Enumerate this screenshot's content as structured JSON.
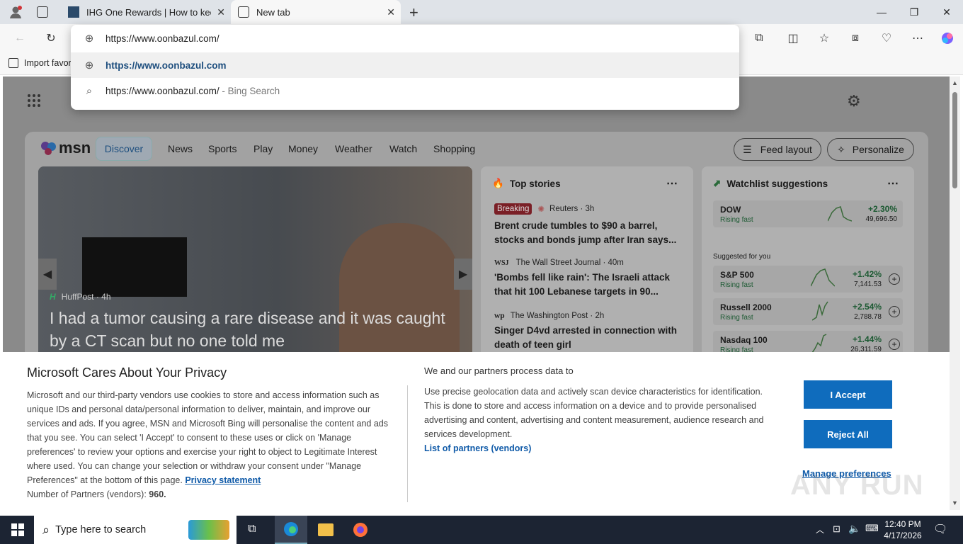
{
  "browser": {
    "tabs": [
      {
        "title": "IHG One Rewards | How to keep y",
        "active": false
      },
      {
        "title": "New tab",
        "active": true
      }
    ],
    "address": "https://www.oonbazul.com/",
    "suggestions": [
      {
        "text": "https://www.oonbazul.com",
        "icon": "globe-icon",
        "suffix": ""
      },
      {
        "text": "https://www.oonbazul.com/",
        "icon": "search-icon",
        "suffix": " - Bing Search"
      }
    ],
    "favorites_label": "Import favor"
  },
  "msn": {
    "logo": "msn",
    "nav": [
      "Discover",
      "News",
      "Sports",
      "Play",
      "Money",
      "Weather",
      "Watch",
      "Shopping"
    ],
    "feed_layout": "Feed layout",
    "personalize": "Personalize",
    "hero": {
      "source": "HuffPost",
      "age": "4h",
      "headline": "I had a tumor causing a rare disease and it was caught by a CT scan but no one told me"
    },
    "top_stories": {
      "title": "Top stories",
      "items": [
        {
          "badge": "Breaking",
          "source": "Reuters · 3h",
          "headline": "Brent crude tumbles to $90 a barrel, stocks and bonds jump after Iran says..."
        },
        {
          "badge": "",
          "source": "The Wall Street Journal · 40m",
          "headline": "'Bombs fell like rain': The Israeli attack that hit 100 Lebanese targets in 90..."
        },
        {
          "badge": "",
          "source": "The Washington Post · 2h",
          "headline": "Singer D4vd arrested in connection with death of teen girl"
        }
      ]
    },
    "watchlist": {
      "title": "Watchlist suggestions",
      "suggested_label": "Suggested for you",
      "items": [
        {
          "name": "DOW",
          "sub": "Rising fast",
          "change": "+2.30%",
          "value": "49,696.50"
        },
        {
          "name": "S&P 500",
          "sub": "Rising fast",
          "change": "+1.42%",
          "value": "7,141.53"
        },
        {
          "name": "Russell 2000",
          "sub": "Rising fast",
          "change": "+2.54%",
          "value": "2,788.78"
        },
        {
          "name": "Nasdaq 100",
          "sub": "Rising fast",
          "change": "+1.44%",
          "value": "26,311.59"
        }
      ]
    }
  },
  "privacy": {
    "title": "Microsoft Cares About Your Privacy",
    "body": "Microsoft and our third-party vendors use cookies to store and access information such as unique IDs and personal data/personal information to deliver, maintain, and improve our services and ads. If you agree, MSN and Microsoft Bing will personalise the content and ads that you see. You can select 'I Accept' to consent to these uses or click on 'Manage preferences' to review your options and exercise your right to object to Legitimate Interest where used. You can change your selection or withdraw your consent under \"Manage Preferences\" at the bottom of this page.",
    "privacy_link": "Privacy statement",
    "partners_label": "Number of Partners (vendors):",
    "partners_count": "960.",
    "right_title": "We and our partners process data to",
    "right_body": "Use precise geolocation data and actively scan device characteristics for identification. This is done to store and access information on a device and to provide personalised advertising and content, advertising and content measurement, audience research and services development.",
    "vendors_link": "List of partners (vendors)",
    "accept": "I Accept",
    "reject": "Reject All",
    "manage": "Manage preferences"
  },
  "taskbar": {
    "search_placeholder": "Type here to search",
    "time": "12:40 PM",
    "date": "4/17/2026"
  },
  "watermark": "ANY RUN",
  "colors": {
    "accent": "#0f6cbd",
    "breaking": "#c50f1f",
    "positive": "#0b7a3b"
  }
}
